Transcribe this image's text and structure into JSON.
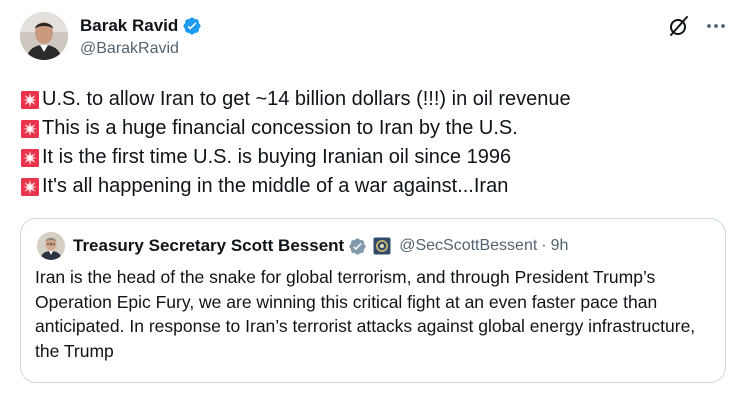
{
  "author": {
    "display_name": "Barak Ravid",
    "handle": "@BarakRavid",
    "verified": true
  },
  "icons": {
    "verified": "verified-badge-icon",
    "grok": "grok-icon",
    "more": "more-icon",
    "siren": "police-light-emoji"
  },
  "tweet_lines": [
    "U.S. to allow Iran to get ~14 billion dollars (!!!) in oil revenue",
    "This is a huge financial concession to Iran by the U.S.",
    "It is the first time U.S. is buying Iranian oil since 1996",
    "It's all happening in the middle of a war against...Iran"
  ],
  "quote": {
    "display_name": "Treasury Secretary Scott Bessent",
    "handle": "@SecScottBessent",
    "separator": "·",
    "time": "9h",
    "text": "Iran is the head of the snake for global terrorism, and through President Trump’s Operation Epic Fury, we are winning this critical fight at an even faster pace than anticipated.  In response to Iran’s terrorist attacks against global energy infrastructure, the Trump"
  },
  "colors": {
    "text": "#0f1419",
    "secondary": "#536471",
    "verified_blue": "#1d9bf0",
    "border": "#cfd9de",
    "siren_red": "#e8334a"
  }
}
